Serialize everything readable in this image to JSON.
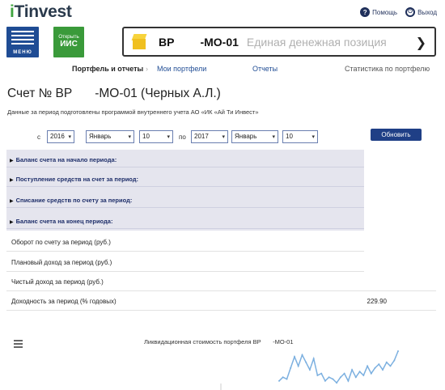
{
  "header": {
    "logo_i": "i",
    "logo_rest": "Tinvest",
    "help_label": "Помощь",
    "logout_label": "Выход",
    "help_icon": "question-circle-icon",
    "logout_icon": "power-icon"
  },
  "menu_button": {
    "label": "МЕНЮ"
  },
  "iis_button": {
    "line1": "Открыть",
    "line2": "ИИС"
  },
  "account_selector": {
    "code_prefix": "BP",
    "code_suffix": "-MO-01",
    "description": "Единая денежная позиция"
  },
  "tabs": {
    "active": "Портфель и отчеты",
    "items": [
      "Мои портфели",
      "Отчеты",
      "Статистика по портфелю"
    ]
  },
  "page": {
    "title_prefix": "Счет № ВР",
    "title_suffix": "-МО-01 (Черных А.Л.)",
    "subtitle": "Данные за период подготовлены программой внутреннего учета АО «ИК «Ай Ти Инвест»"
  },
  "filter": {
    "from_label": "с",
    "to_label": "по",
    "from": {
      "year": "2016",
      "month": "Январь",
      "day": "10"
    },
    "to": {
      "year": "2017",
      "month": "Январь",
      "day": "10"
    },
    "refresh_label": "Обновить"
  },
  "collapsible_rows": [
    "Баланс счета на начало периода:",
    "Поступление средств на счет за период:",
    "Списание средств по счету за период:",
    "Баланс счета на конец периода:"
  ],
  "summary_rows": [
    {
      "label": "Оборот по счету за период (руб.)",
      "value": ""
    },
    {
      "label": "Плановый доход за период (руб.)",
      "value": ""
    },
    {
      "label": "Чистый доход за период (руб.)",
      "value": ""
    },
    {
      "label": "Доходность за период (% годовых)",
      "value": "229.90"
    }
  ],
  "chart": {
    "title": "Ликвидационная стоимость портфеля BP       -MO-01",
    "line_color": "#7cb0e0"
  },
  "chart_data": {
    "type": "line",
    "title": "Ликвидационная стоимость портфеля BP       -MO-01",
    "xlabel": "",
    "ylabel": "",
    "series": [
      {
        "values": [
          0.2,
          0.3,
          0.25,
          0.55,
          0.85,
          0.6,
          0.9,
          0.7,
          0.5,
          0.8,
          0.35,
          0.4,
          0.2,
          0.3,
          0.25,
          0.15,
          0.3,
          0.4,
          0.2,
          0.5,
          0.3,
          0.45,
          0.35,
          0.6,
          0.4,
          0.55,
          0.65,
          0.5,
          0.7,
          0.6,
          0.75,
          1.0
        ]
      }
    ]
  }
}
